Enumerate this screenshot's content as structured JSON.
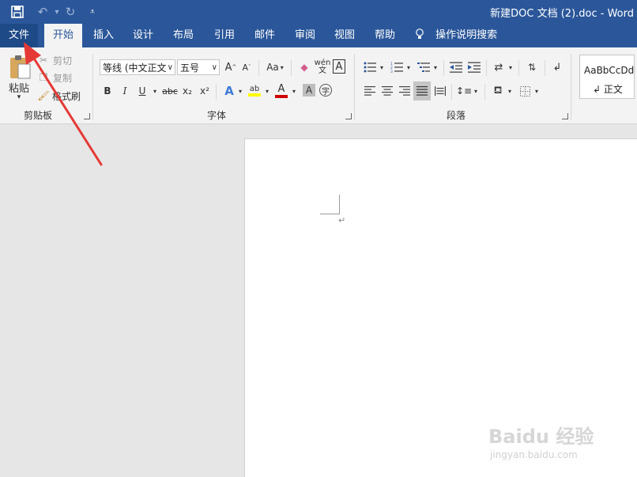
{
  "window": {
    "doc_title": "新建DOC 文档 (2).doc  -  Word"
  },
  "quick_access": {
    "save": "save-icon",
    "undo": "undo-icon",
    "redo": "redo-icon",
    "customize": "customize-icon"
  },
  "tabs": [
    "文件",
    "开始",
    "插入",
    "设计",
    "布局",
    "引用",
    "邮件",
    "审阅",
    "视图",
    "帮助"
  ],
  "tell_me": "操作说明搜索",
  "clipboard": {
    "paste": "粘贴",
    "cut": "剪切",
    "copy": "复制",
    "format_painter": "格式刷",
    "label": "剪贴板"
  },
  "font": {
    "name": "等线 (中文正文)",
    "size": "五号",
    "grow": "A",
    "shrink": "A",
    "case": "Aa",
    "phonetic_top": "wén",
    "phonetic_bottom": "文",
    "border_char": "A",
    "bold": "B",
    "italic": "I",
    "underline": "U",
    "strike": "abc",
    "sub": "x₂",
    "sup": "x²",
    "effects": "A",
    "highlight": "ab",
    "font_color": "A",
    "shading": "A",
    "enclose": "字",
    "label": "字体"
  },
  "paragraph": {
    "label": "段落"
  },
  "styles": {
    "sample": "AaBbCcDd",
    "name": "↲ 正文"
  },
  "document": {
    "para_mark": "↵"
  },
  "watermark": {
    "brand": "Baidu 经验",
    "url": "jingyan.baidu.com"
  },
  "colors": {
    "accent": "#2b579a",
    "highlight": "#ffff00",
    "font_color": "#d00000",
    "arrow": "#e53935"
  }
}
